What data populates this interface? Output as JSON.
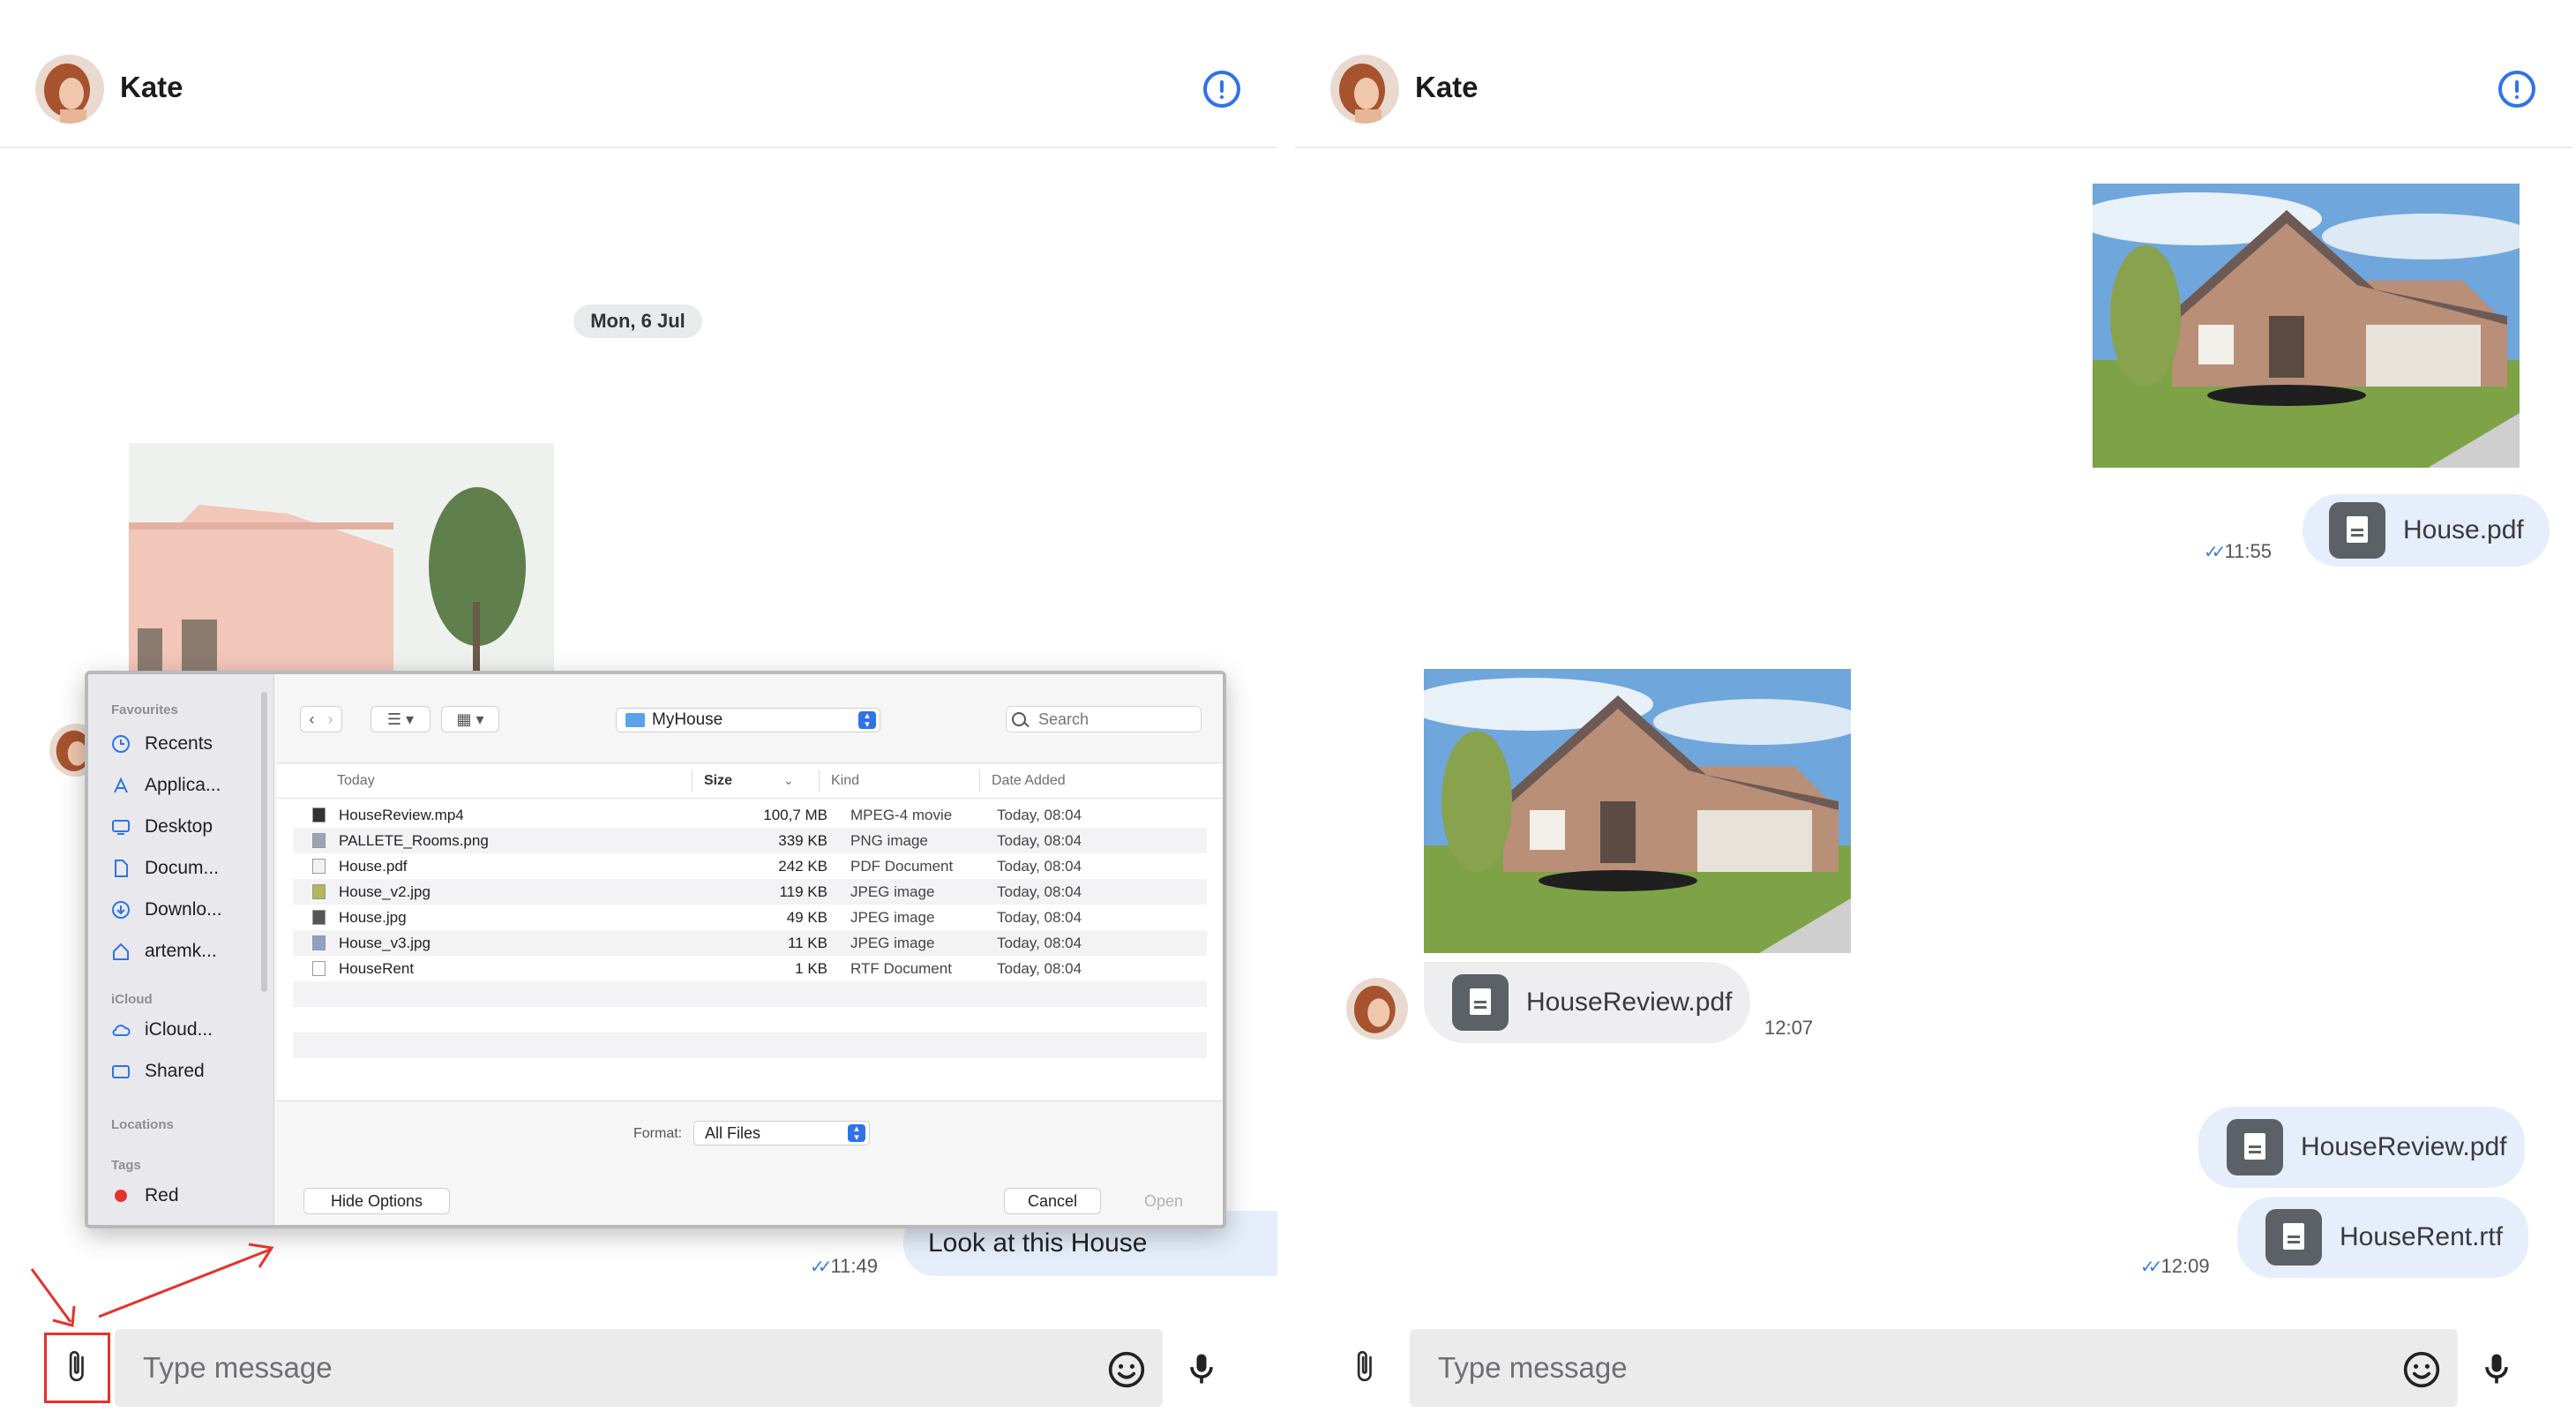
{
  "left": {
    "header": {
      "name": "Kate"
    },
    "date_divider": "Mon, 6 Jul",
    "outgoing_message": {
      "text": "Look at this House",
      "time": "11:49"
    },
    "composer": {
      "placeholder": "Type message"
    }
  },
  "right": {
    "header": {
      "name": "Kate"
    },
    "messages": [
      {
        "direction": "outgoing",
        "type": "image"
      },
      {
        "direction": "outgoing",
        "type": "file",
        "file": "House.pdf",
        "time": "11:55"
      },
      {
        "direction": "incoming",
        "type": "image"
      },
      {
        "direction": "incoming",
        "type": "file",
        "file": "HouseReview.pdf",
        "time": "12:07"
      },
      {
        "direction": "outgoing",
        "type": "file",
        "file": "HouseReview.pdf"
      },
      {
        "direction": "outgoing",
        "type": "file",
        "file": "HouseRent.rtf",
        "time": "12:09"
      }
    ],
    "composer": {
      "placeholder": "Type message"
    }
  },
  "file_dialog": {
    "sidebar": {
      "favourites_label": "Favourites",
      "favourites": [
        "Recents",
        "Applica...",
        "Desktop",
        "Docum...",
        "Downlo...",
        "artemk..."
      ],
      "icloud_label": "iCloud",
      "icloud": [
        "iCloud...",
        "Shared"
      ],
      "locations_label": "Locations",
      "tags_label": "Tags",
      "tags": [
        "Red"
      ]
    },
    "location": "MyHouse",
    "search_placeholder": "Search",
    "columns": {
      "name": "Today",
      "size": "Size",
      "kind": "Kind",
      "date": "Date Added"
    },
    "files": [
      {
        "name": "HouseReview.mp4",
        "size": "100,7 MB",
        "kind": "MPEG-4 movie",
        "date": "Today, 08:04"
      },
      {
        "name": "PALLETE_Rooms.png",
        "size": "339 KB",
        "kind": "PNG image",
        "date": "Today, 08:04"
      },
      {
        "name": "House.pdf",
        "size": "242 KB",
        "kind": "PDF Document",
        "date": "Today, 08:04"
      },
      {
        "name": "House_v2.jpg",
        "size": "119 KB",
        "kind": "JPEG image",
        "date": "Today, 08:04"
      },
      {
        "name": "House.jpg",
        "size": "49 KB",
        "kind": "JPEG image",
        "date": "Today, 08:04"
      },
      {
        "name": "House_v3.jpg",
        "size": "11 KB",
        "kind": "JPEG image",
        "date": "Today, 08:04"
      },
      {
        "name": "HouseRent",
        "size": "1 KB",
        "kind": "RTF Document",
        "date": "Today, 08:04"
      }
    ],
    "format_label": "Format:",
    "format_value": "All Files",
    "hide_options": "Hide Options",
    "cancel": "Cancel",
    "open": "Open"
  },
  "colors": {
    "accent": "#2f73e8",
    "outgoing_bubble": "#e6eefb",
    "incoming_bubble": "#eeeef0",
    "annotation": "#e5322b"
  },
  "icons": [
    "info-icon",
    "paperclip-icon",
    "emoji-icon",
    "microphone-icon",
    "document-icon",
    "double-check-icon"
  ]
}
